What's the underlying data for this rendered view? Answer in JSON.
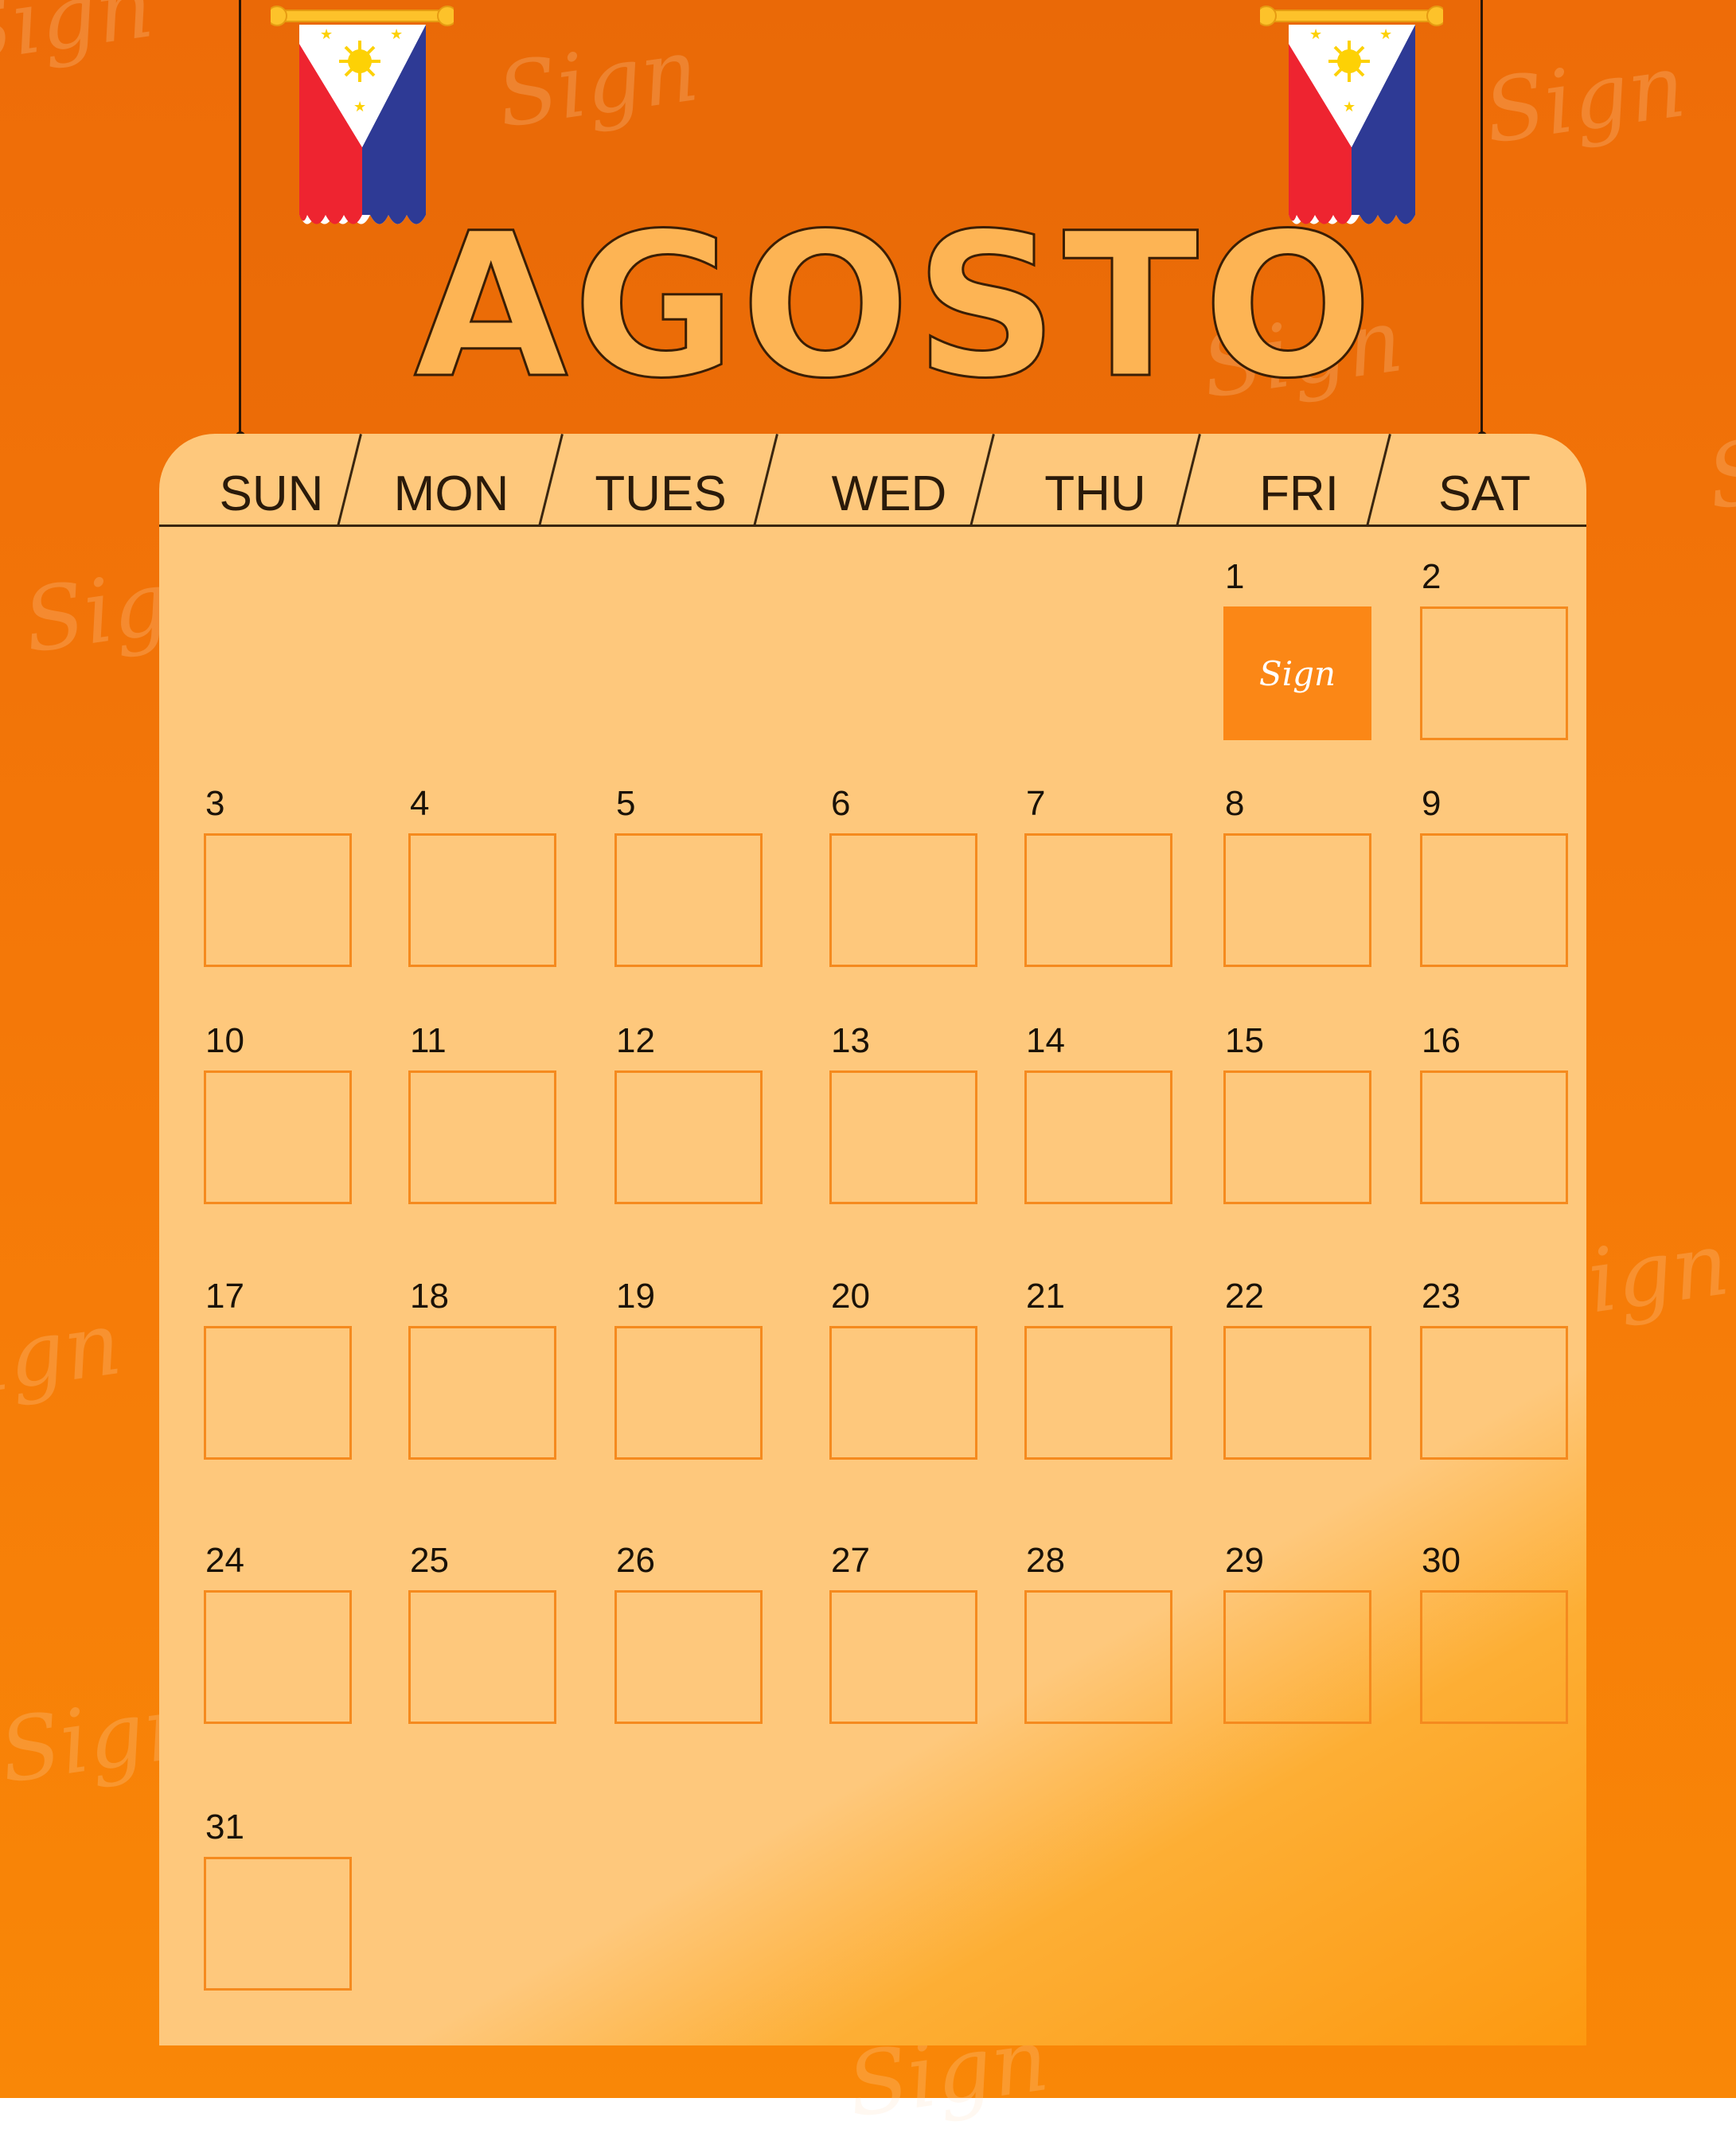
{
  "calendar": {
    "month_title": "AGOSTO",
    "weekdays": [
      "SUN",
      "MON",
      "TUES",
      "WED",
      "THU",
      "FRI",
      "SAT"
    ],
    "first_weekday_index": 5,
    "days_in_month": 31,
    "highlight": {
      "day": 1,
      "text": "Sign"
    }
  },
  "watermark_text": "Sign",
  "decorations": {
    "flag_icon": "philippine-flag-pennant-icon",
    "colors": {
      "background": "#f07408",
      "card": "#fec87c",
      "box_border": "#f58a1e",
      "highlight_box": "#fb8716",
      "flag_red": "#ee2430",
      "flag_blue": "#2e3a95",
      "flag_sun": "#fdd105"
    }
  }
}
